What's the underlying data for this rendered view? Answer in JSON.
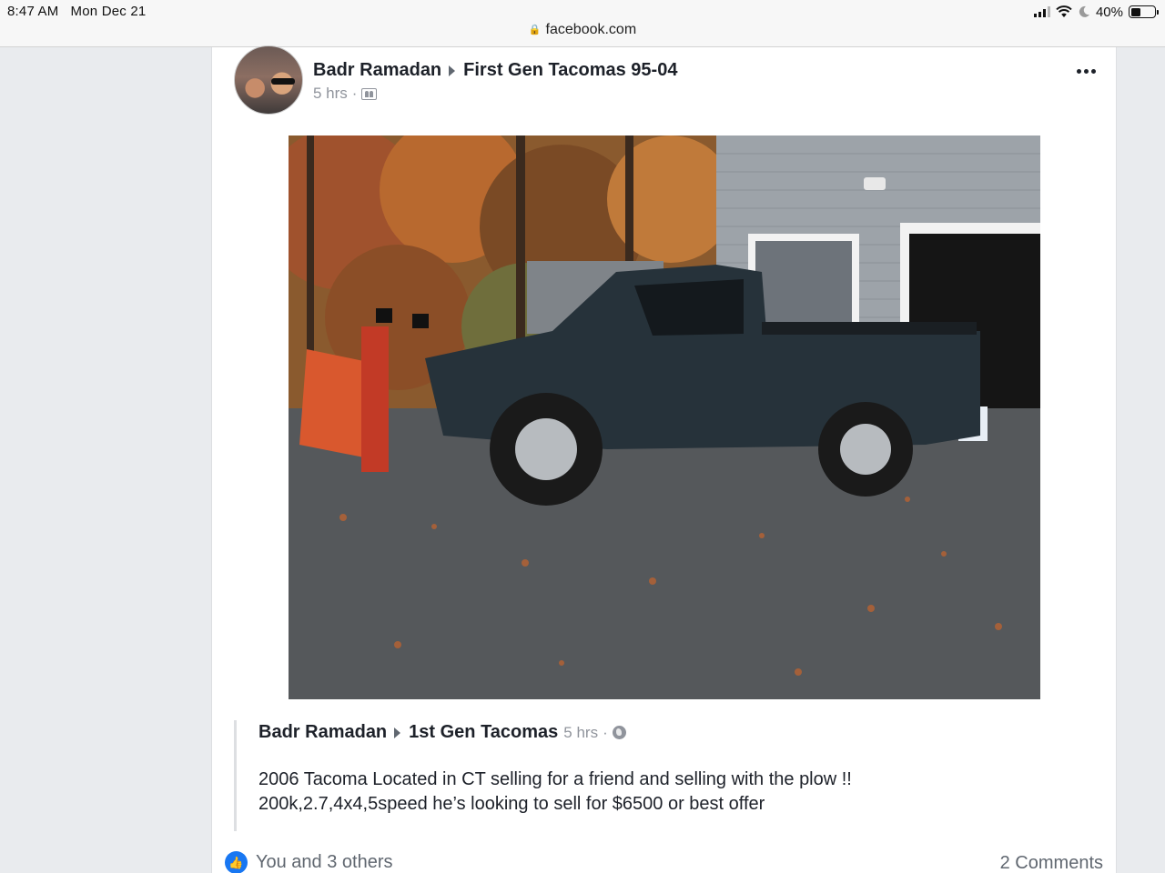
{
  "status_bar": {
    "time": "8:47 AM",
    "date": "Mon Dec 21",
    "battery": "40%",
    "battery_level": 0.4
  },
  "browser": {
    "url": "facebook.com"
  },
  "post": {
    "author": "Badr Ramadan",
    "group": "First Gen Tacomas 95-04",
    "time": "5 hrs",
    "separator": "·",
    "audience_icon": "group-icon",
    "more_icon": "more-options-icon"
  },
  "shared_post": {
    "author": "Badr Ramadan",
    "group": "1st Gen Tacomas",
    "time": "5 hrs",
    "separator": "·",
    "audience_icon": "globe-icon",
    "line1": "2006 Tacoma Located in CT selling for a friend and selling with the plow !!",
    "line2": "200k,2.7,4x4,5speed he’s looking to sell for $6500 or best offer"
  },
  "footer": {
    "likes_text": "You and 3 others",
    "comments_text": "2 Comments"
  },
  "colors": {
    "facebook_blue": "#1877f2",
    "page_bg": "#e9ebee",
    "meta_gray": "#90949c"
  }
}
